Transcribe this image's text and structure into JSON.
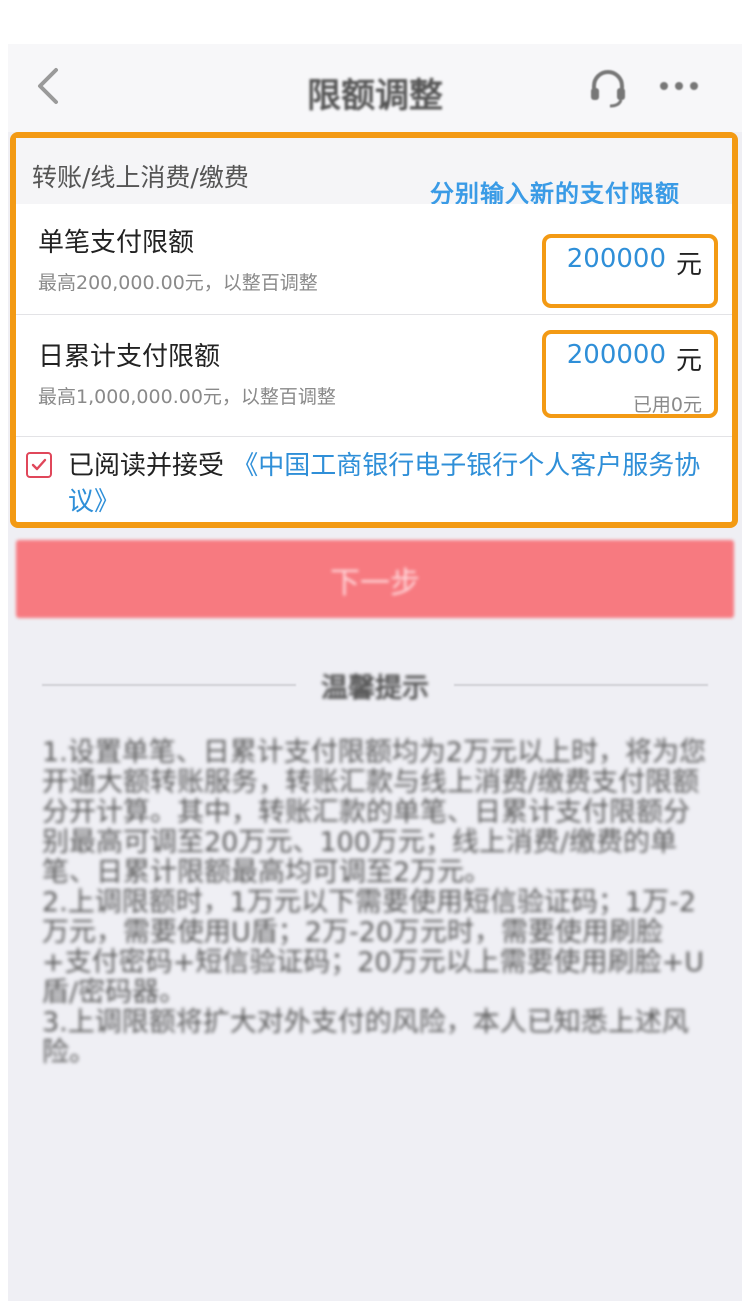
{
  "nav": {
    "title": "限额调整",
    "back_icon": "chevron-left-icon",
    "service_icon": "headset-icon",
    "more_icon": "more-dots-icon"
  },
  "section": {
    "title": "转账/线上消费/缴费"
  },
  "annotation": "分别输入新的支付限额",
  "single_limit": {
    "label": "单笔支付限额",
    "hint": "最高200,000.00元，以整百调整",
    "value": "200000",
    "unit": "元"
  },
  "daily_limit": {
    "label": "日累计支付限额",
    "hint": "最高1,000,000.00元，以整百调整",
    "value": "200000",
    "unit": "元",
    "used": "已用0元"
  },
  "agreement": {
    "checked": true,
    "prefix": "已阅读并接受",
    "link": "《中国工商银行电子银行个人客户服务协议》"
  },
  "next_button": "下一步",
  "tips": {
    "title": "温馨提示",
    "items": [
      "1.设置单笔、日累计支付限额均为2万元以上时，将为您开通大额转账服务，转账汇款与线上消费/缴费支付限额分开计算。其中，转账汇款的单笔、日累计支付限额分别最高可调至20万元、100万元；线上消费/缴费的单笔、日累计限额最高均可调至2万元。",
      "2.上调限额时，1万元以下需要使用短信验证码；1万-2万元，需要使用U盾；2万-20万元时，需要使用刷脸+支付密码+短信验证码；20万元以上需要使用刷脸+U盾/密码器。",
      "3.上调限额将扩大对外支付的风险，本人已知悉上述风险。"
    ]
  },
  "colors": {
    "highlight": "#f39a14",
    "link_blue": "#2f8fd8",
    "button_red": "#f77a80",
    "checkbox_red": "#e0475a"
  }
}
